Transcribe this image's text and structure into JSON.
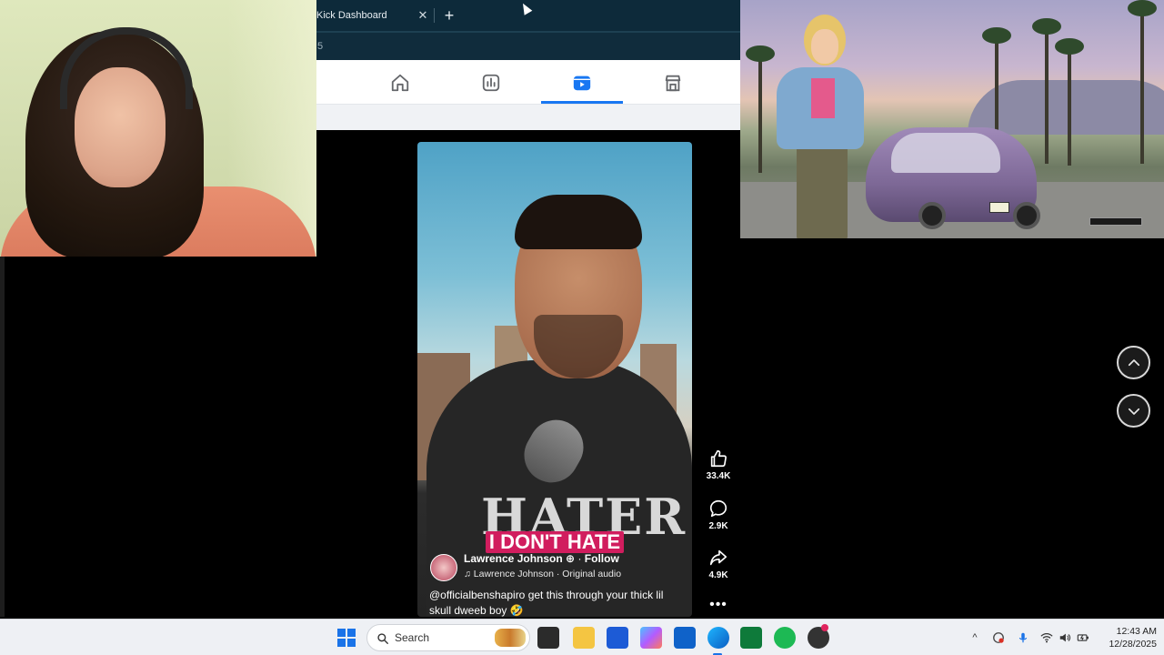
{
  "browser": {
    "tab_title": "Kick Dashboard",
    "tab_close": "✕",
    "new_tab": "+",
    "address_fragment": "5",
    "nav": [
      "home-icon",
      "dashboard-icon",
      "video-icon",
      "marketplace-icon"
    ],
    "active_nav": "video-icon",
    "accent": "#1877f2"
  },
  "video": {
    "caption": "I DON'T HATE",
    "shirt_text": "HATER",
    "author_name": "Lawrence Johnson",
    "follow": "Follow",
    "separator": "·",
    "audio": "♫ Lawrence Johnson · Original audio",
    "post_text": "@officialbenshapiro get this through your thick lil skull dweeb boy 🤣",
    "actions": {
      "like_count": "33.4K",
      "comment_count": "2.9K",
      "share_count": "4.9K",
      "more": "•••"
    }
  },
  "scroll_nav": {
    "up_icon": "chevron-up-icon",
    "down_icon": "chevron-down-icon"
  },
  "taskbar": {
    "search_label": "Search",
    "time": "12:43 AM",
    "date": "12/28/2025",
    "tray_caret": "^"
  }
}
